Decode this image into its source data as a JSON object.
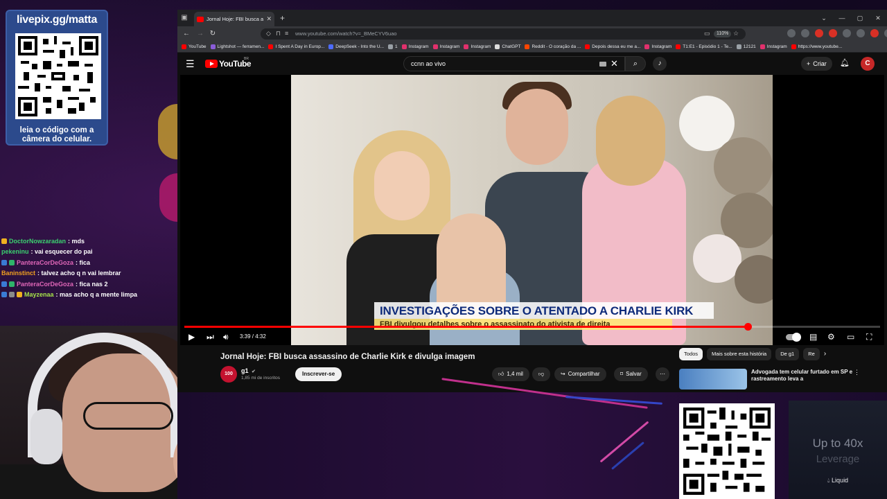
{
  "overlay": {
    "livepix_title": "livepix.gg/matta",
    "livepix_caption": "leia o código com a câmera do celular.",
    "ad_headline": "Up to 40x",
    "ad_sub": "Leverage",
    "ad_brand": "Liquid"
  },
  "chat": [
    {
      "user": "DoctorNowzaradan",
      "message": ": mds",
      "color": "#3bd16f"
    },
    {
      "user": "pekeninu",
      "message": ": vai esquecer do pai",
      "color": "#3bd16f"
    },
    {
      "user": "PanteraCorDeGoza",
      "message": ": fica",
      "color": "#e066b8"
    },
    {
      "user": "Baninstinct",
      "message": ": talvez acho q n vai lembrar",
      "color": "#f0a020"
    },
    {
      "user": "PanteraCorDeGoza",
      "message": ": fica nas 2",
      "color": "#e066b8"
    },
    {
      "user": "Mayzenaa",
      "message": ": mas acho q a mente limpa",
      "color": "#a6e24a"
    }
  ],
  "browser": {
    "tab_title": "Jornal Hoje: FBI busca assassin",
    "url": "www.youtube.com/watch?v=_BMeCYV6uao",
    "zoom": "110%",
    "bookmarks": [
      "YouTube",
      "Lightshot — ferramen...",
      "I Spent A Day in Europ...",
      "DeepSeek - Into the U...",
      "1",
      "Instagram",
      "Instagram",
      "Instagram",
      "ChatGPT",
      "Reddit - O coração da ...",
      "Depois dessa eu me a...",
      "Instagram",
      "T1:E1 - Episódio 1 - Te...",
      "12121",
      "Instagram",
      "https://www.youtube..."
    ]
  },
  "youtube": {
    "logo": "YouTube",
    "region": "BR",
    "search_query": "ccnn ao vivo",
    "create_label": "Criar",
    "avatar_letter": "C",
    "lower_third_title": "INVESTIGAÇÕES SOBRE O ATENTADO A CHARLIE KIRK",
    "lower_third_sub": "FBI divulgou detalhes sobre o assassinato do ativista de direita",
    "time": "3:39 / 4:32",
    "progress": 0.81,
    "video_title": "Jornal Hoje: FBI busca assassino de Charlie Kirk e divulga imagem",
    "channel_name": "g1",
    "channel_avatar": "100",
    "channel_subs": "1,85 mi de inscritos",
    "subscribe_label": "Inscrever-se",
    "likes": "1,4 mil",
    "share_label": "Compartilhar",
    "save_label": "Salvar",
    "chips": [
      "Todos",
      "Mais sobre esta história",
      "De g1",
      "Re"
    ],
    "rec_title": "Advogada tem celular furtado em SP e rastreamento leva a"
  },
  "colors": {
    "youtube_red": "#ff0000",
    "lower_third_blue": "#0d2a7a",
    "livepix_blue": "#2c4a8c"
  }
}
